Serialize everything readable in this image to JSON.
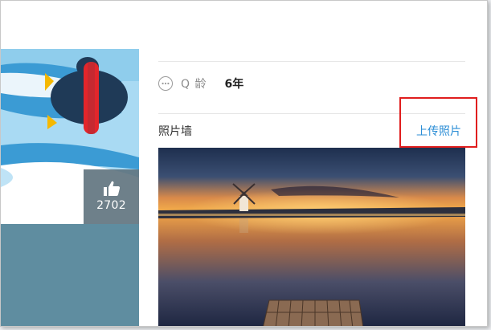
{
  "profile": {
    "like_count": "2702"
  },
  "info": {
    "qage_label": "Q 龄",
    "qage_value": "6年"
  },
  "photo_wall": {
    "title": "照片墙",
    "upload_label": "上传照片"
  },
  "colors": {
    "link": "#2c8ed6",
    "highlight": "#e01e1e",
    "banner_sky": "#a9daf3",
    "banner_bottom": "#5f8da0"
  },
  "icons": {
    "more": "ellipsis-circle-icon",
    "like": "thumbs-up-icon"
  }
}
